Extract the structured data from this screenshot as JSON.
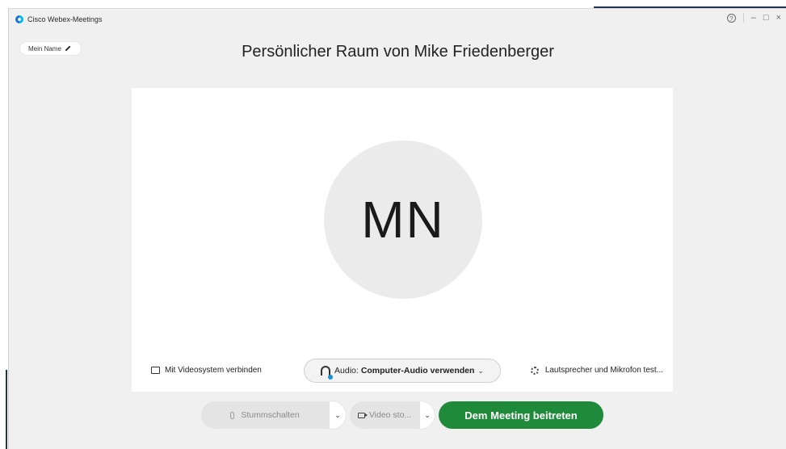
{
  "window": {
    "title": "Cisco Webex-Meetings",
    "controls": {
      "help": "?",
      "minimize": "–",
      "maximize": "□",
      "close": "×"
    }
  },
  "header": {
    "name_label": "Mein Name",
    "room_title": "Persönlicher Raum von Mike Friedenberger"
  },
  "preview": {
    "initials": "MN",
    "connect_video_system": "Mit Videosystem verbinden",
    "audio_prefix": "Audio:",
    "audio_value": "Computer-Audio verwenden",
    "audio_chevron": "⌄",
    "speaker_test": "Lautsprecher und Mikrofon test..."
  },
  "controls": {
    "mute_label": "Stummschalten",
    "video_label": "Video sto...",
    "caret": "⌄",
    "join_label": "Dem Meeting beitreten"
  },
  "colors": {
    "join_green": "#1f8a3a",
    "accent_navy": "#1f3551",
    "webex_blue": "#1d6fd6"
  }
}
